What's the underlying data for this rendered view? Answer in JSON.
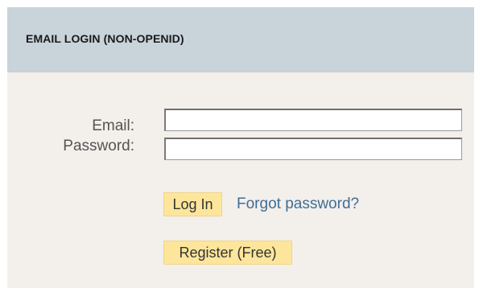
{
  "login_panel": {
    "title": "EMAIL LOGIN (NON-OPENID)",
    "email_label": "Email:",
    "password_label": "Password:",
    "email_value": "",
    "password_value": "",
    "login_button": "Log In",
    "forgot_link": "Forgot password?",
    "register_button": "Register (Free)"
  },
  "colors": {
    "header_background": "#c8d3da",
    "body_background": "#f3efeb",
    "button_background": "#fde59b",
    "link": "#3f6e95"
  }
}
